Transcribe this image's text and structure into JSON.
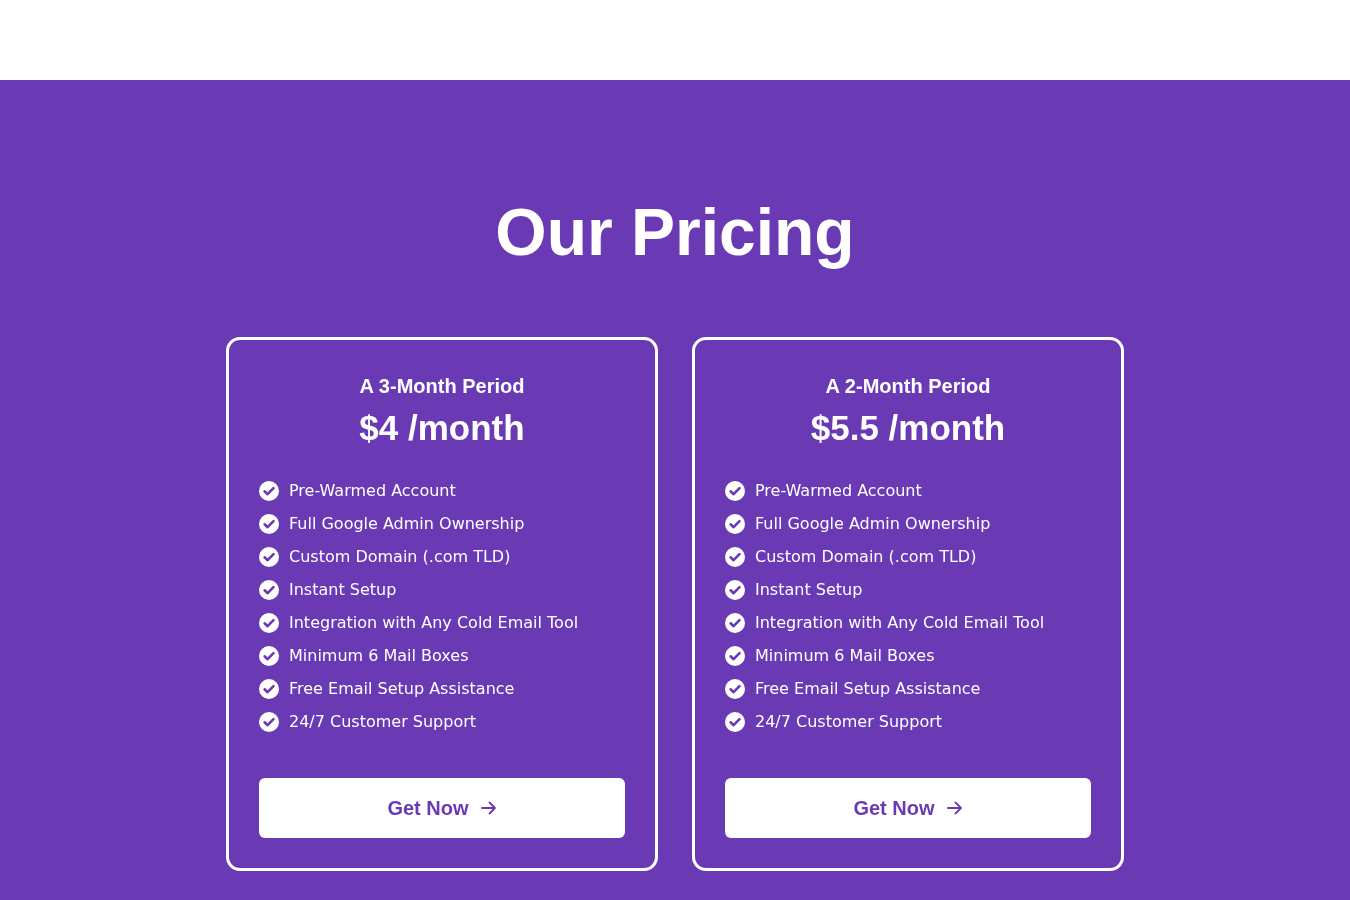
{
  "section": {
    "title": "Our Pricing"
  },
  "plans": [
    {
      "period": "A 3-Month Period",
      "price": "$4 /month",
      "features": [
        "Pre-Warmed Account",
        "Full Google Admin Ownership",
        "Custom Domain (.com TLD)",
        "Instant Setup",
        "Integration with Any Cold Email Tool",
        "Minimum 6 Mail Boxes",
        "Free Email Setup Assistance",
        "24/7 Customer Support"
      ],
      "button": {
        "label": "Get Now"
      }
    },
    {
      "period": "A 2-Month Period",
      "price": "$5.5 /month",
      "features": [
        "Pre-Warmed Account",
        "Full Google Admin Ownership",
        "Custom Domain (.com TLD)",
        "Instant Setup",
        "Integration with Any Cold Email Tool",
        "Minimum 6 Mail Boxes",
        "Free Email Setup Assistance",
        "24/7 Customer Support"
      ],
      "button": {
        "label": "Get Now"
      }
    }
  ]
}
